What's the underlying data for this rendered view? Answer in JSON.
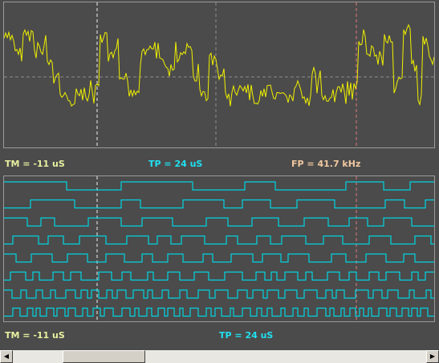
{
  "colors": {
    "background": "#4b4b4b",
    "panel_border": "#9a9a9a",
    "analog_trace": "#f0f000",
    "digital_trace": "#00d4e0",
    "grid": "#8c8c8c",
    "cursor_time": "#f0f0f0",
    "cursor_marker": "#e07a7a",
    "tm_text": "#e8f0a0",
    "tp_text": "#20e0f0",
    "fp_text": "#f0c8a0"
  },
  "analog_readouts": {
    "tm": "TM = -11 uS",
    "tp": "TP = 24 uS",
    "fp": "FP = 41.7 kHz"
  },
  "digital_readouts": {
    "tm": "TM = -11 uS",
    "tp": "TP = 24 uS"
  },
  "channel_count": 8,
  "scrollbar": {
    "left_arrow_icon": "arrow-left-icon",
    "right_arrow_icon": "arrow-right-icon",
    "thumb_position_fraction": 0.15
  }
}
